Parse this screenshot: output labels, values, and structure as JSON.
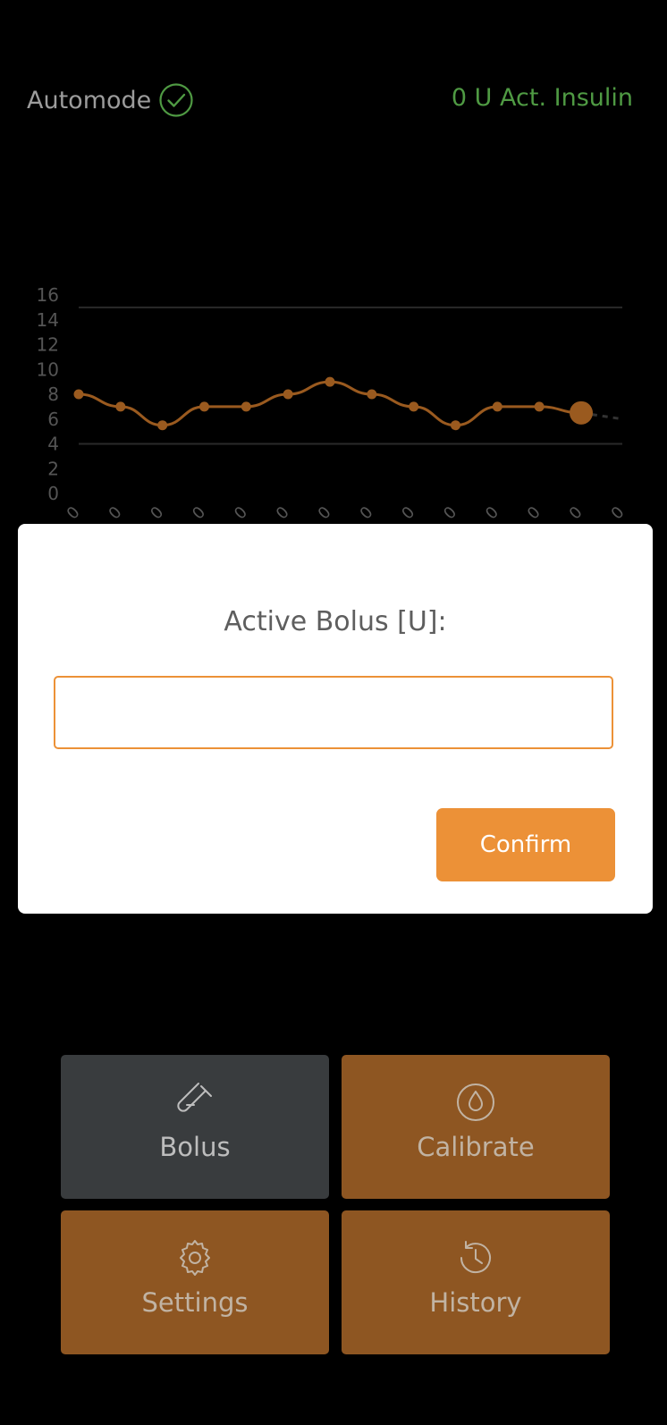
{
  "header": {
    "automode_label": "Automode",
    "automode_icon": "check-circle-icon",
    "act_insulin_text": "0 U Act. Insulin"
  },
  "colors": {
    "accent": "#ec9137",
    "line": "#9a5a1f",
    "ok_green": "#4f9a43",
    "tile_brown": "#8e5622",
    "tile_gray": "#393c3e"
  },
  "chart_data": {
    "type": "line",
    "y_ticks": [
      "16",
      "14",
      "12",
      "10",
      "8",
      "6",
      "4",
      "2",
      "0"
    ],
    "ylim": [
      0,
      16
    ],
    "gridlines": [
      4,
      15
    ],
    "series": [
      {
        "values": [
          8,
          7,
          5.5,
          7,
          7,
          8,
          9,
          8,
          7,
          5.5,
          7,
          7,
          6.5
        ]
      }
    ],
    "forecast_value": 6
  },
  "modal": {
    "title": "Active Bolus [U]:",
    "input_value": "",
    "input_placeholder": "",
    "confirm_label": "Confirm"
  },
  "tiles": [
    {
      "label": "Bolus",
      "icon": "test-tube-icon"
    },
    {
      "label": "Calibrate",
      "icon": "water-drop-icon"
    },
    {
      "label": "Settings",
      "icon": "gear-icon"
    },
    {
      "label": "History",
      "icon": "history-clock-icon"
    }
  ]
}
